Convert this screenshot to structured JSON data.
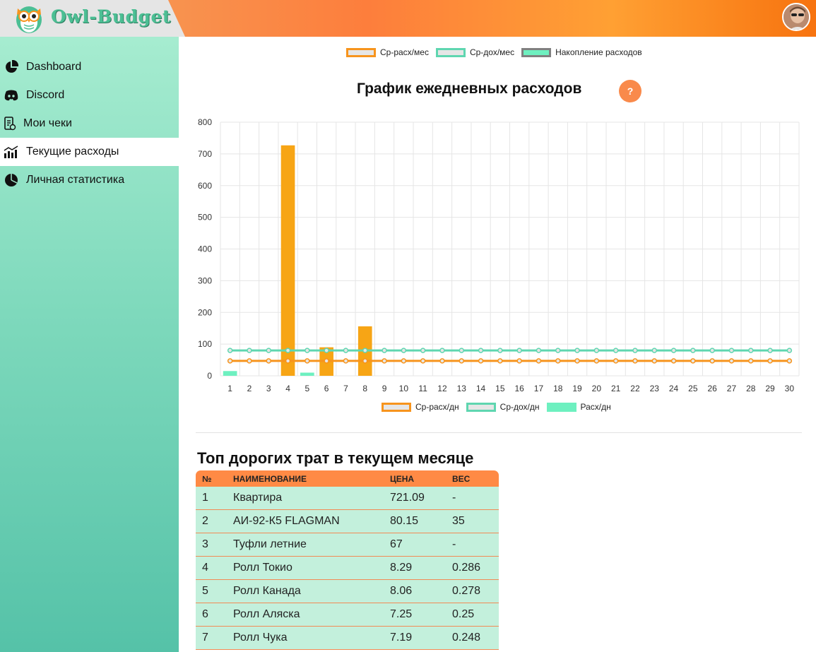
{
  "header": {
    "app_name": "Owl-Budget"
  },
  "sidebar": {
    "items": [
      {
        "label": "Dashboard",
        "icon": "pie-chart-icon"
      },
      {
        "label": "Discord",
        "icon": "discord-icon"
      },
      {
        "label": "Мои чеки",
        "icon": "receipt-icon"
      },
      {
        "label": "Текущие расходы",
        "icon": "bar-chart-icon",
        "active": true
      },
      {
        "label": "Личная статистика",
        "icon": "pie-chart-icon"
      }
    ]
  },
  "top_legend": [
    {
      "label": "Ср-расх/мес",
      "color": "#f7941d",
      "fill": "#e6e6e6"
    },
    {
      "label": "Ср-дох/мес",
      "color": "#5fd6b0",
      "fill": "#e6e6e6"
    },
    {
      "label": "Накопление расходов",
      "color": "#808080",
      "fill": "#6ef0c0"
    }
  ],
  "daily_chart": {
    "title": "График ежедневных расходов",
    "help_label": "?"
  },
  "chart_data": {
    "type": "bar",
    "x": [
      1,
      2,
      3,
      4,
      5,
      6,
      7,
      8,
      9,
      10,
      11,
      12,
      13,
      14,
      15,
      16,
      17,
      18,
      19,
      20,
      21,
      22,
      23,
      24,
      25,
      26,
      27,
      28,
      29,
      30
    ],
    "ylim": [
      0,
      800
    ],
    "yticks": [
      0,
      100,
      200,
      300,
      400,
      500,
      600,
      700,
      800
    ],
    "grid": true,
    "legend_position": "bottom",
    "series": [
      {
        "name": "Ср-расх/дн",
        "type": "line",
        "color": "#f7941d",
        "values": [
          47,
          47,
          47,
          47,
          47,
          47,
          47,
          47,
          47,
          47,
          47,
          47,
          47,
          47,
          47,
          47,
          47,
          47,
          47,
          47,
          47,
          47,
          47,
          47,
          47,
          47,
          47,
          47,
          47,
          47
        ]
      },
      {
        "name": "Ср-дох/дн",
        "type": "line",
        "color": "#5fd6b0",
        "values": [
          80,
          80,
          80,
          80,
          80,
          80,
          80,
          80,
          80,
          80,
          80,
          80,
          80,
          80,
          80,
          80,
          80,
          80,
          80,
          80,
          80,
          80,
          80,
          80,
          80,
          80,
          80,
          80,
          80,
          80
        ]
      },
      {
        "name": "Расх/дн",
        "type": "bar",
        "color": "#6ef0c0",
        "values": [
          15,
          0,
          0,
          0,
          10,
          0,
          0,
          0,
          0,
          0,
          0,
          0,
          0,
          0,
          0,
          0,
          0,
          0,
          0,
          0,
          0,
          0,
          0,
          0,
          0,
          0,
          0,
          0,
          0,
          0
        ]
      },
      {
        "type": "bar",
        "color": "#f7a515",
        "values": [
          0,
          0,
          0,
          727,
          0,
          90,
          0,
          156,
          0,
          0,
          0,
          0,
          0,
          0,
          0,
          0,
          0,
          0,
          0,
          0,
          0,
          0,
          0,
          0,
          0,
          0,
          0,
          0,
          0,
          0
        ]
      }
    ]
  },
  "top_expenses": {
    "title": "Топ дорогих трат в текущем месяце",
    "columns": [
      "№",
      "НАИМЕНОВАНИЕ",
      "ЦЕНА",
      "ВЕС"
    ],
    "rows": [
      [
        "1",
        "Квартира",
        "721.09",
        "-"
      ],
      [
        "2",
        "АИ-92-К5 FLAGMAN",
        "80.15",
        "35"
      ],
      [
        "3",
        "Туфли летние",
        "67",
        "-"
      ],
      [
        "4",
        "Ролл Токио",
        "8.29",
        "0.286"
      ],
      [
        "5",
        "Ролл Канада",
        "8.06",
        "0.278"
      ],
      [
        "6",
        "Ролл Аляска",
        "7.25",
        "0.25"
      ],
      [
        "7",
        "Ролл Чука",
        "7.19",
        "0.248"
      ]
    ]
  }
}
